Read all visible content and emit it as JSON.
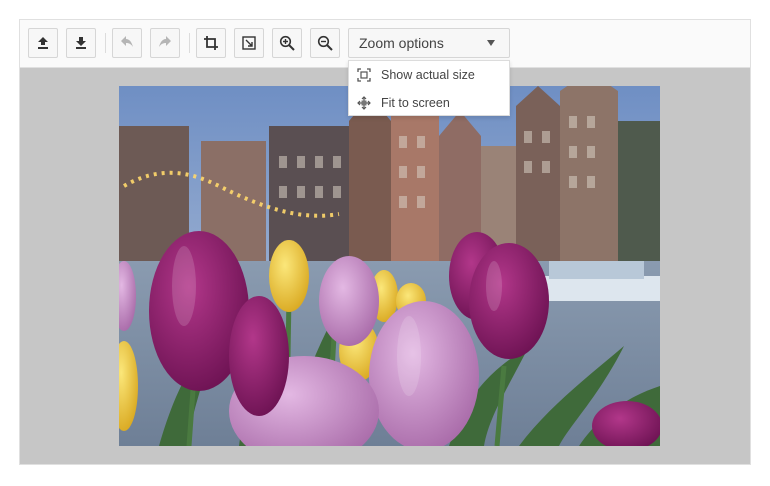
{
  "toolbar": {
    "buttons": [
      {
        "name": "upload",
        "icon": "upload-icon"
      },
      {
        "name": "download",
        "icon": "download-icon"
      },
      {
        "name": "undo",
        "icon": "undo-icon"
      },
      {
        "name": "redo",
        "icon": "redo-icon"
      },
      {
        "name": "crop",
        "icon": "crop-icon"
      },
      {
        "name": "resize",
        "icon": "resize-icon"
      },
      {
        "name": "zoom-in",
        "icon": "zoom-in-icon"
      },
      {
        "name": "zoom-out",
        "icon": "zoom-out-icon"
      }
    ],
    "zoom_select": {
      "label": "Zoom options",
      "options": [
        {
          "label": "Show actual size",
          "icon": "actual-size-icon"
        },
        {
          "label": "Fit to screen",
          "icon": "fit-to-screen-icon"
        }
      ]
    }
  },
  "image": {
    "description_icon": "photo-tulips-canal-houses",
    "colors": {
      "sky": "#8aa6cc",
      "tulip_purple": "#8c1f6a",
      "tulip_pink": "#c894c8",
      "tulip_yellow": "#f2d23a",
      "leaf_green": "#3f6a3a"
    }
  }
}
